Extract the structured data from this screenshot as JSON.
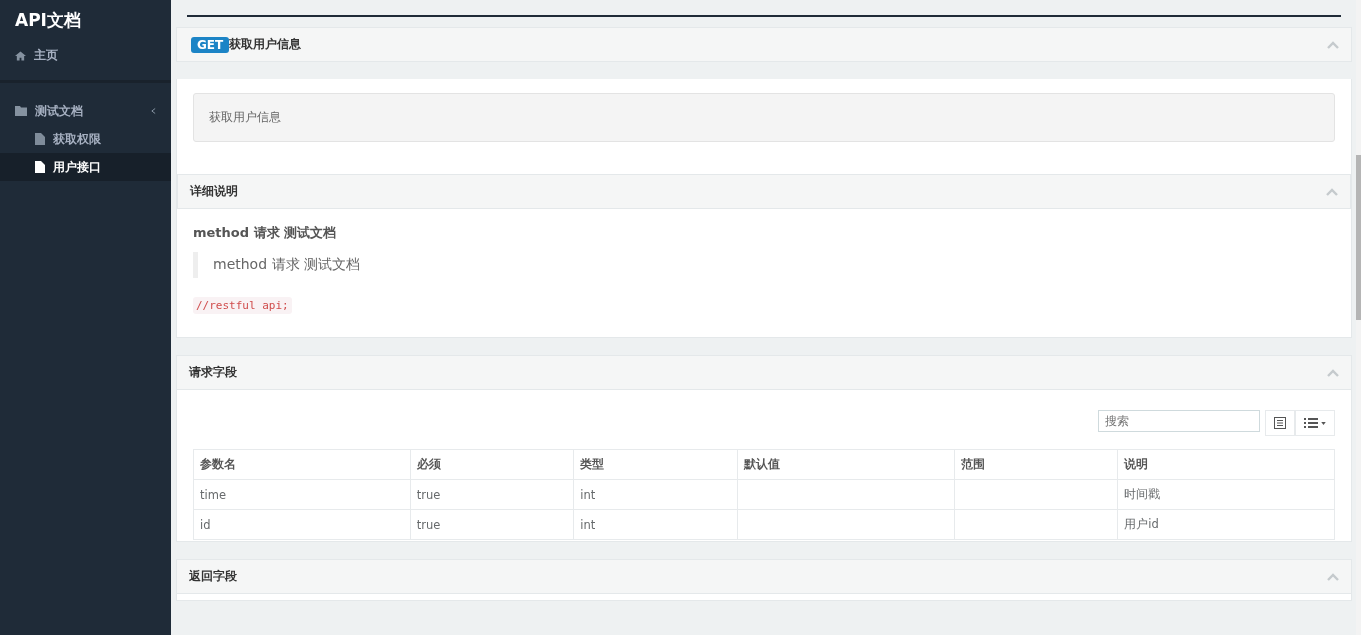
{
  "sidebar": {
    "title": "API文档",
    "home": "主页",
    "groups": [
      {
        "label": "测试文档",
        "expanded": true,
        "children": [
          {
            "label": "获取权限",
            "selected": false
          },
          {
            "label": "用户接口",
            "selected": true
          }
        ]
      }
    ]
  },
  "api": {
    "method": "GET",
    "title": "获取用户信息",
    "description": "获取用户信息"
  },
  "detail": {
    "title": "详细说明",
    "heading": "method 请求 测试文档",
    "quote": "method 请求 测试文档",
    "code": "//restful api;"
  },
  "request_fields": {
    "title": "请求字段",
    "search": {
      "placeholder": "搜索"
    },
    "columns": [
      "参数名",
      "必须",
      "类型",
      "默认值",
      "范围",
      "说明"
    ],
    "rows": [
      [
        "time",
        "true",
        "int",
        "",
        "",
        "时间戳"
      ],
      [
        "id",
        "true",
        "int",
        "",
        "",
        "用户id"
      ]
    ]
  },
  "response_fields": {
    "title": "返回字段"
  }
}
